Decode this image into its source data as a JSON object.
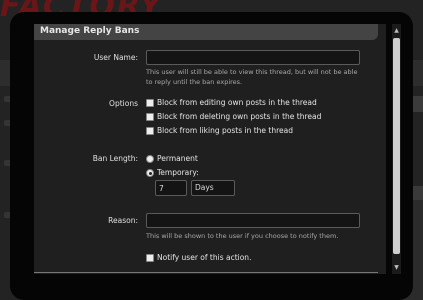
{
  "background": {
    "logo_text": "FACTORY"
  },
  "dialog": {
    "title": "Manage Reply Bans",
    "user_name_label": "User Name:",
    "user_name_value": "",
    "user_name_hint": "This user will still be able to view this thread, but will not be able to reply until the ban expires.",
    "options_label": "Options",
    "options": [
      {
        "label": "Block from editing own posts in the thread",
        "checked": false
      },
      {
        "label": "Block from deleting own posts in the thread",
        "checked": false
      },
      {
        "label": "Block from liking posts in the thread",
        "checked": false
      }
    ],
    "ban_length_label": "Ban Length:",
    "permanent_label": "Permanent",
    "temporary_label": "Temporary:",
    "selected_length": "Temporary",
    "temporary_amount": "7",
    "temporary_unit": "Days",
    "reason_label": "Reason:",
    "reason_value": "",
    "reason_hint": "This will be shown to the user if you choose to notify them.",
    "notify_label": "Notify user of this action.",
    "notify_checked": false
  },
  "scrollbar": {
    "up_arrow": "▲",
    "down_arrow": "▼"
  }
}
